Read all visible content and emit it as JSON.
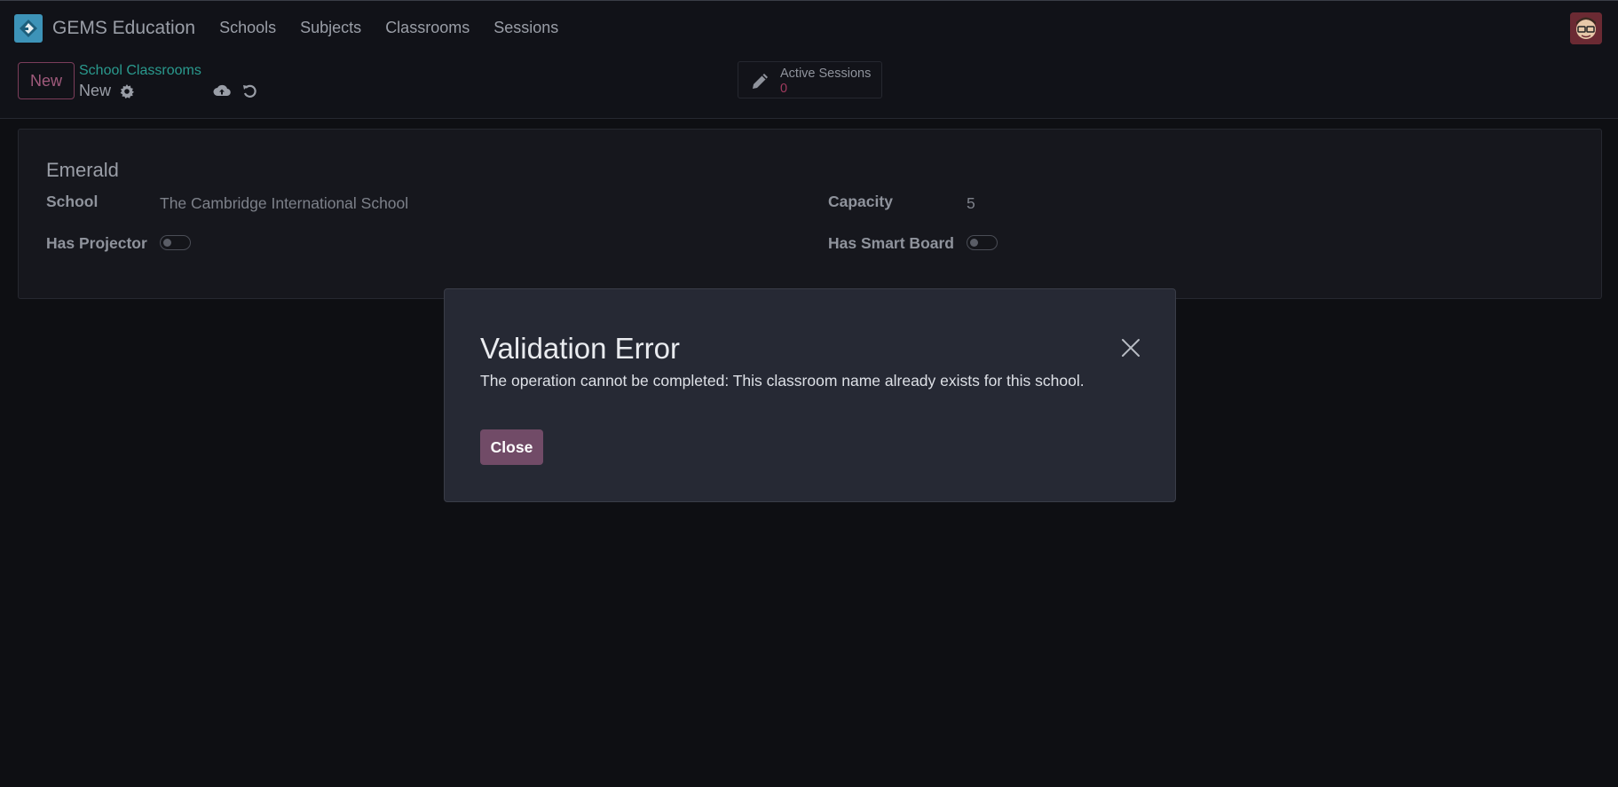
{
  "navbar": {
    "app_name": "GEMS Education",
    "menu": [
      "Schools",
      "Subjects",
      "Classrooms",
      "Sessions"
    ],
    "logo_icon": "app-logo-icon",
    "avatar_icon": "user-avatar"
  },
  "control_panel": {
    "new_label": "New",
    "breadcrumb": "School Classrooms",
    "record_name": "New",
    "stat_button": {
      "label": "Active Sessions",
      "value": "0"
    }
  },
  "form": {
    "title": "Emerald",
    "fields": {
      "school_label": "School",
      "school_value": "The Cambridge International School",
      "capacity_label": "Capacity",
      "capacity_value": "5",
      "has_projector_label": "Has Projector",
      "has_projector_value": false,
      "has_smart_board_label": "Has Smart Board",
      "has_smart_board_value": false
    }
  },
  "dialog": {
    "title": "Validation Error",
    "message": "The operation cannot be completed: This classroom name already exists for this school.",
    "close_label": "Close"
  },
  "colors": {
    "accent": "#714b67",
    "link": "#2a9a8e",
    "background": "#0e0f13"
  }
}
